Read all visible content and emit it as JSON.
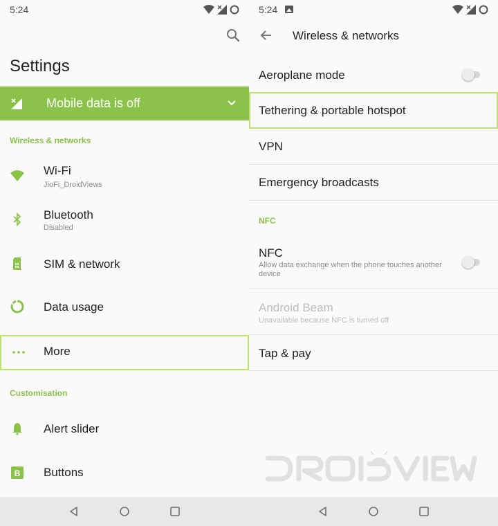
{
  "left": {
    "status": {
      "time": "5:24"
    },
    "title": "Settings",
    "banner": {
      "text": "Mobile data is off",
      "color": "#8bc34a"
    },
    "sections": [
      "Wireless & networks",
      "Customisation"
    ],
    "items": [
      {
        "label": "Wi-Fi",
        "sub": "JioFi_DroidViews",
        "icon": "wifi-icon"
      },
      {
        "label": "Bluetooth",
        "sub": "Disabled",
        "icon": "bluetooth-icon"
      },
      {
        "label": "SIM & network",
        "sub": "",
        "icon": "sim-card-icon"
      },
      {
        "label": "Data usage",
        "sub": "",
        "icon": "data-usage-icon"
      },
      {
        "label": "More",
        "sub": "",
        "icon": "more-dots-icon"
      },
      {
        "label": "Alert slider",
        "sub": "",
        "icon": "bell-icon"
      },
      {
        "label": "Buttons",
        "sub": "",
        "icon": "b-square-icon"
      }
    ]
  },
  "right": {
    "status": {
      "time": "5:24"
    },
    "title": "Wireless & networks",
    "section": "NFC",
    "items": [
      {
        "label": "Aeroplane mode",
        "toggle": "off"
      },
      {
        "label": "Tethering & portable hotspot"
      },
      {
        "label": "VPN"
      },
      {
        "label": "Emergency broadcasts"
      },
      {
        "label": "NFC",
        "sub": "Allow data exchange when the phone touches another device",
        "toggle": "off"
      },
      {
        "label": "Android Beam",
        "sub": "Unavailable because NFC is turned off",
        "disabled": true
      },
      {
        "label": "Tap & pay"
      }
    ]
  },
  "colors": {
    "accent": "#8bc34a",
    "highlight": "#b9e36a",
    "watermark": "#e0e0e0"
  },
  "nav_buttons": [
    "back-icon",
    "home-icon",
    "recents-icon"
  ]
}
